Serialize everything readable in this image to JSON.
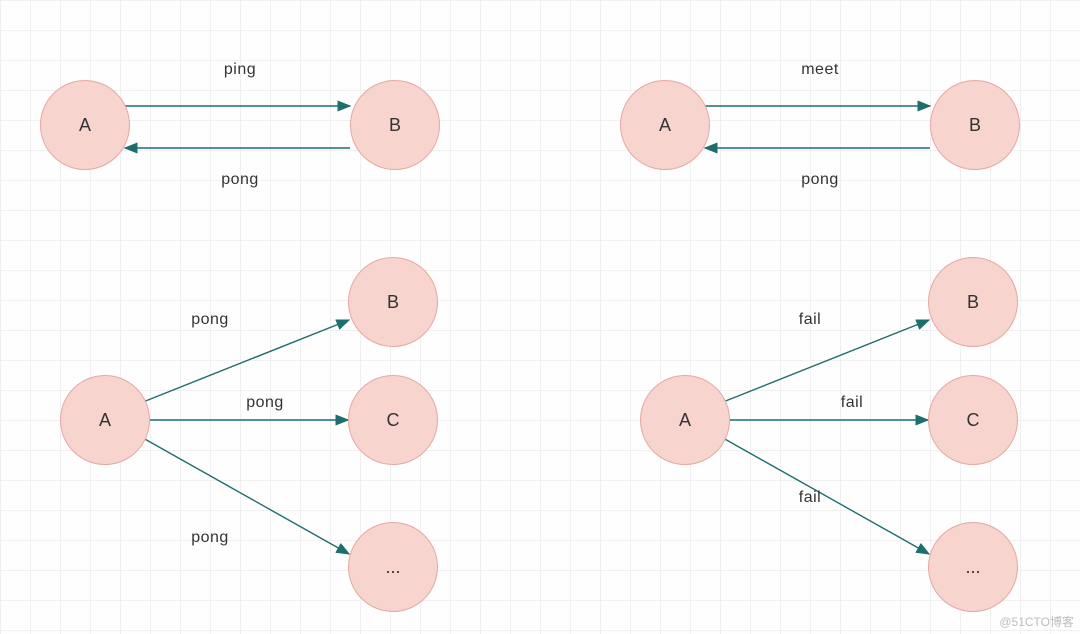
{
  "watermark": "@51CTO博客",
  "colors": {
    "node_fill": "#f8d4cf",
    "node_stroke": "#e6a8a0",
    "arrow": "#1f6e6e"
  },
  "diagrams": {
    "top_left": {
      "node_a": "A",
      "node_b": "B",
      "arrow_top": "ping",
      "arrow_bottom": "pong"
    },
    "top_right": {
      "node_a": "A",
      "node_b": "B",
      "arrow_top": "meet",
      "arrow_bottom": "pong"
    },
    "bottom_left": {
      "node_a": "A",
      "targets": {
        "b": "B",
        "c": "C",
        "d": "..."
      },
      "edge_labels": {
        "to_b": "pong",
        "to_c": "pong",
        "to_d": "pong"
      }
    },
    "bottom_right": {
      "node_a": "A",
      "targets": {
        "b": "B",
        "c": "C",
        "d": "..."
      },
      "edge_labels": {
        "to_b": "fail",
        "to_c": "fail",
        "to_d": "fail"
      }
    }
  }
}
